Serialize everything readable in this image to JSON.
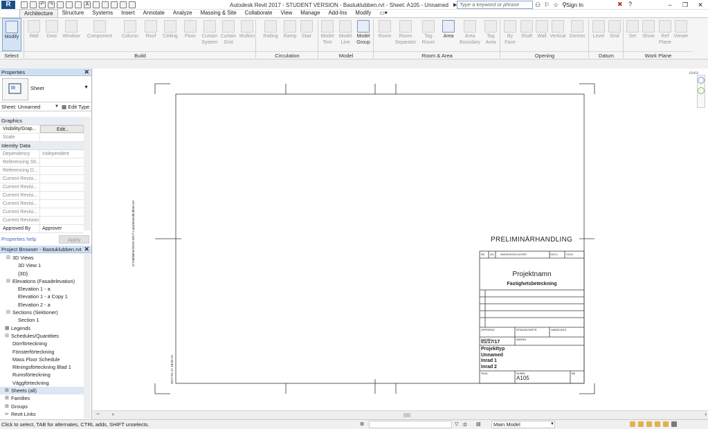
{
  "app": {
    "logo": "R",
    "title": "Autodesk Revit 2017 - STUDENT VERSION -    Bastuklubben.rvt - Sheet: A105 - Unnamed"
  },
  "search": {
    "placeholder": "Type a keyword or phrase"
  },
  "signin": "Sign In",
  "tabs": [
    "Architecture",
    "Structure",
    "Systems",
    "Insert",
    "Annotate",
    "Analyze",
    "Massing & Site",
    "Collaborate",
    "View",
    "Manage",
    "Add-Ins",
    "Modify"
  ],
  "ribbon": {
    "modify": "Modify",
    "select_panel": "Select",
    "build_tools": [
      "Wall",
      "Door",
      "Window",
      "Component",
      "Column",
      "Roof",
      "Ceiling",
      "Floor",
      "Curtain System",
      "Curtain Grid",
      "Mullion"
    ],
    "circulation_tools": [
      "Railing",
      "Ramp",
      "Stair"
    ],
    "model_tools": [
      "Model Text",
      "Model Line",
      "Model Group"
    ],
    "room_tools": [
      "Room",
      "Room Separator",
      "Tag Room",
      "Area",
      "Area Boundary",
      "Tag Area"
    ],
    "opening_tools": [
      "By Face",
      "Shaft",
      "Wall",
      "Vertical",
      "Dormer"
    ],
    "datum_tools": [
      "Level",
      "Grid"
    ],
    "workplane_tools": [
      "Set",
      "Show",
      "Ref Plane",
      "Viewer"
    ],
    "panels": [
      "Build",
      "Circulation",
      "Model",
      "Room & Area",
      "Opening",
      "Datum",
      "Work Plane"
    ]
  },
  "properties": {
    "header": "Properties",
    "type_name": "Sheet",
    "instance": "Sheet: Unnamed",
    "edit_type": "Edit Type",
    "group_graphics": "Graphics",
    "group_identity": "Identity Data",
    "rows": [
      {
        "k": "Visibility/Grap...",
        "v": "Edit..."
      },
      {
        "k": "Scale",
        "v": ""
      },
      {
        "k": "Dependency",
        "v": "Independent"
      },
      {
        "k": "Referencing Sh...",
        "v": ""
      },
      {
        "k": "Referencing D...",
        "v": ""
      },
      {
        "k": "Current Revisi...",
        "v": ""
      },
      {
        "k": "Current Revisi...",
        "v": ""
      },
      {
        "k": "Current Revisi...",
        "v": ""
      },
      {
        "k": "Current Revisi...",
        "v": ""
      },
      {
        "k": "Current Revisi...",
        "v": ""
      },
      {
        "k": "Current Revision",
        "v": ""
      },
      {
        "k": "Approved By",
        "v": "Approver"
      }
    ],
    "help": "Properties help",
    "apply": "Apply"
  },
  "browser": {
    "header": "Project Browser - Bastuklubben.rvt",
    "nodes": [
      {
        "t": "3D Views",
        "lvl": 1,
        "tg": "⊟"
      },
      {
        "t": "3D View 1",
        "lvl": 2,
        "tg": ""
      },
      {
        "t": "{3D}",
        "lvl": 2,
        "tg": ""
      },
      {
        "t": "Elevations (Fasadelevation)",
        "lvl": 1,
        "tg": "⊟"
      },
      {
        "t": "Elevation 1 - a",
        "lvl": 2,
        "tg": ""
      },
      {
        "t": "Elevation 1 - a Copy 1",
        "lvl": 2,
        "tg": ""
      },
      {
        "t": "Elevation 2 - a",
        "lvl": 2,
        "tg": ""
      },
      {
        "t": "Sections (Sektioner)",
        "lvl": 1,
        "tg": "⊟"
      },
      {
        "t": "Section 1",
        "lvl": 2,
        "tg": ""
      },
      {
        "t": "Legends",
        "lvl": 0,
        "tg": "▦"
      },
      {
        "t": "Schedules/Quantities",
        "lvl": 0,
        "tg": "⊟"
      },
      {
        "t": "Dörrförteckning",
        "lvl": 1,
        "tg": ""
      },
      {
        "t": "Fönsterförteckning",
        "lvl": 1,
        "tg": ""
      },
      {
        "t": "Mass Floor Schedule",
        "lvl": 1,
        "tg": ""
      },
      {
        "t": "Ritningsförteckning Blad 1",
        "lvl": 1,
        "tg": ""
      },
      {
        "t": "Rumsförteckning",
        "lvl": 1,
        "tg": ""
      },
      {
        "t": "Väggförteckning",
        "lvl": 1,
        "tg": ""
      },
      {
        "t": "Sheets (all)",
        "lvl": 0,
        "tg": "⊞"
      },
      {
        "t": "Families",
        "lvl": 0,
        "tg": "⊞"
      },
      {
        "t": "Groups",
        "lvl": 0,
        "tg": "⊞"
      },
      {
        "t": "Revit Links",
        "lvl": 0,
        "tg": "∞"
      }
    ]
  },
  "sheet": {
    "stamp": "PRELIMINÄRHANDLING",
    "rev_cols": [
      "BE",
      "ÄN",
      "ÄNDRINGEN AVSER",
      "DATU",
      "SIGN"
    ],
    "project_name": "Projektnamn",
    "subtitle": "Fastighetsbeteckning",
    "col_uppdrag": "UPPDRAG",
    "col_ritad": "RITAD/KONSTR",
    "col_handlagg": "HANDLÄGG",
    "col_datum": "DATUM",
    "col_andra": "ÄNDRA",
    "date": "01/17/17",
    "lines": [
      "Projekttyp",
      "Unnamed",
      "Inrad 1",
      "Inrad 2"
    ],
    "col_skal": "SKAL",
    "col_numm": "NUMM",
    "col_be": "BE",
    "sheet_number": "A105",
    "side_text_1": "D:\\Arkitektur\\2016-2017\\ Larry\\Bastuklubben.rvt",
    "side_text_2": "2017-01-17 18:02:13"
  },
  "status": {
    "hint": "Click to select, TAB for alternates, CTRL adds, SHIFT unselects.",
    "zero": ":0",
    "model": "Main Model"
  }
}
